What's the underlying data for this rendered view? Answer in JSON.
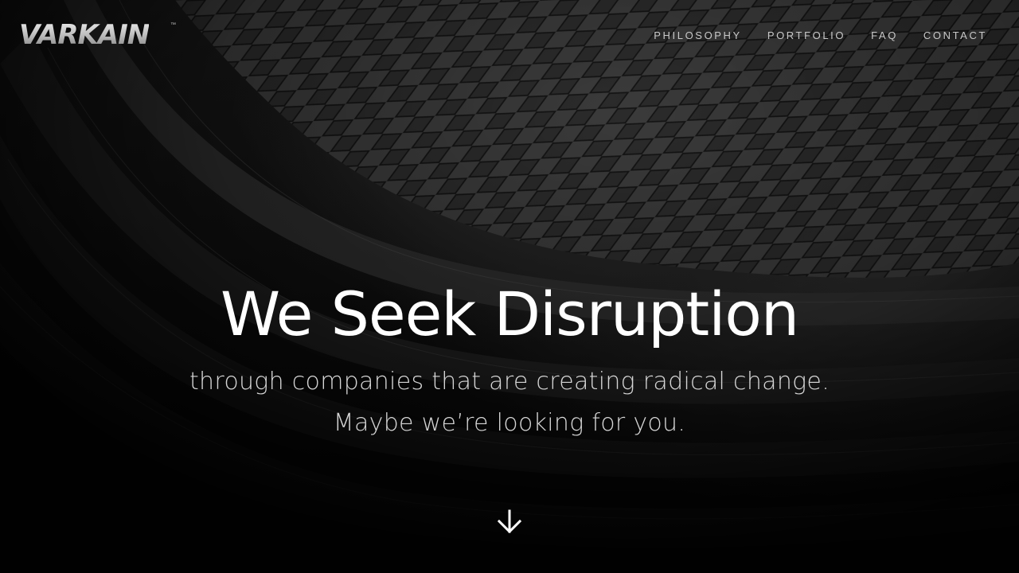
{
  "brand": {
    "logo_text": "VARKAIN",
    "trademark": "™"
  },
  "nav": {
    "items": [
      {
        "label": "PHILOSOPHY"
      },
      {
        "label": "PORTFOLIO"
      },
      {
        "label": "FAQ"
      },
      {
        "label": "CONTACT"
      }
    ]
  },
  "hero": {
    "title": "We Seek Disruption",
    "subtitle_line1": "through companies that are creating radical change.",
    "subtitle_line2": "Maybe we’re looking for you.",
    "scroll_icon": "arrow-down-icon"
  },
  "colors": {
    "background": "#0a0a0a",
    "text_primary": "#ffffff",
    "nav_text": "#c9c9c9"
  }
}
